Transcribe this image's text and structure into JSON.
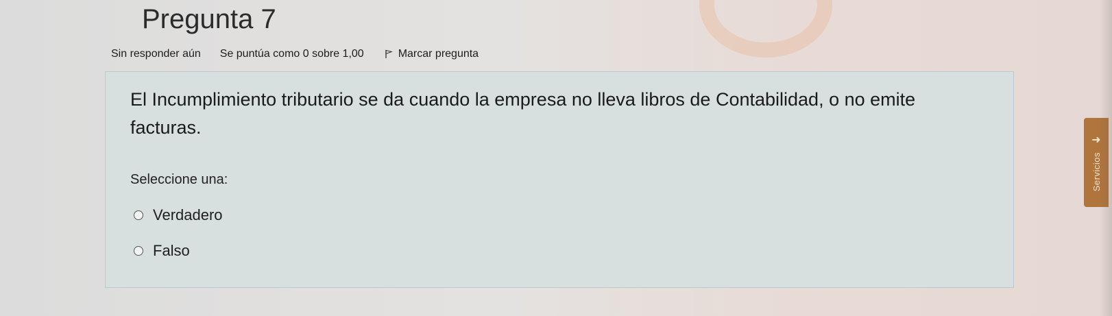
{
  "question": {
    "title": "Pregunta 7",
    "status": "Sin responder aún",
    "grade": "Se puntúa como 0 sobre 1,00",
    "flag_label": "Marcar pregunta",
    "text": "El Incumplimiento tributario se da cuando la empresa no lleva libros de Contabilidad, o no emite facturas.",
    "prompt": "Seleccione una:",
    "options": [
      {
        "label": "Verdadero",
        "selected": false
      },
      {
        "label": "Falso",
        "selected": false
      }
    ]
  },
  "services_tab": {
    "label": "Servicios",
    "icon": "arrow-right-icon"
  },
  "colors": {
    "panel_background": "#d7e0de",
    "panel_border": "#b9cbd0",
    "services_tab": "#b0743d"
  }
}
